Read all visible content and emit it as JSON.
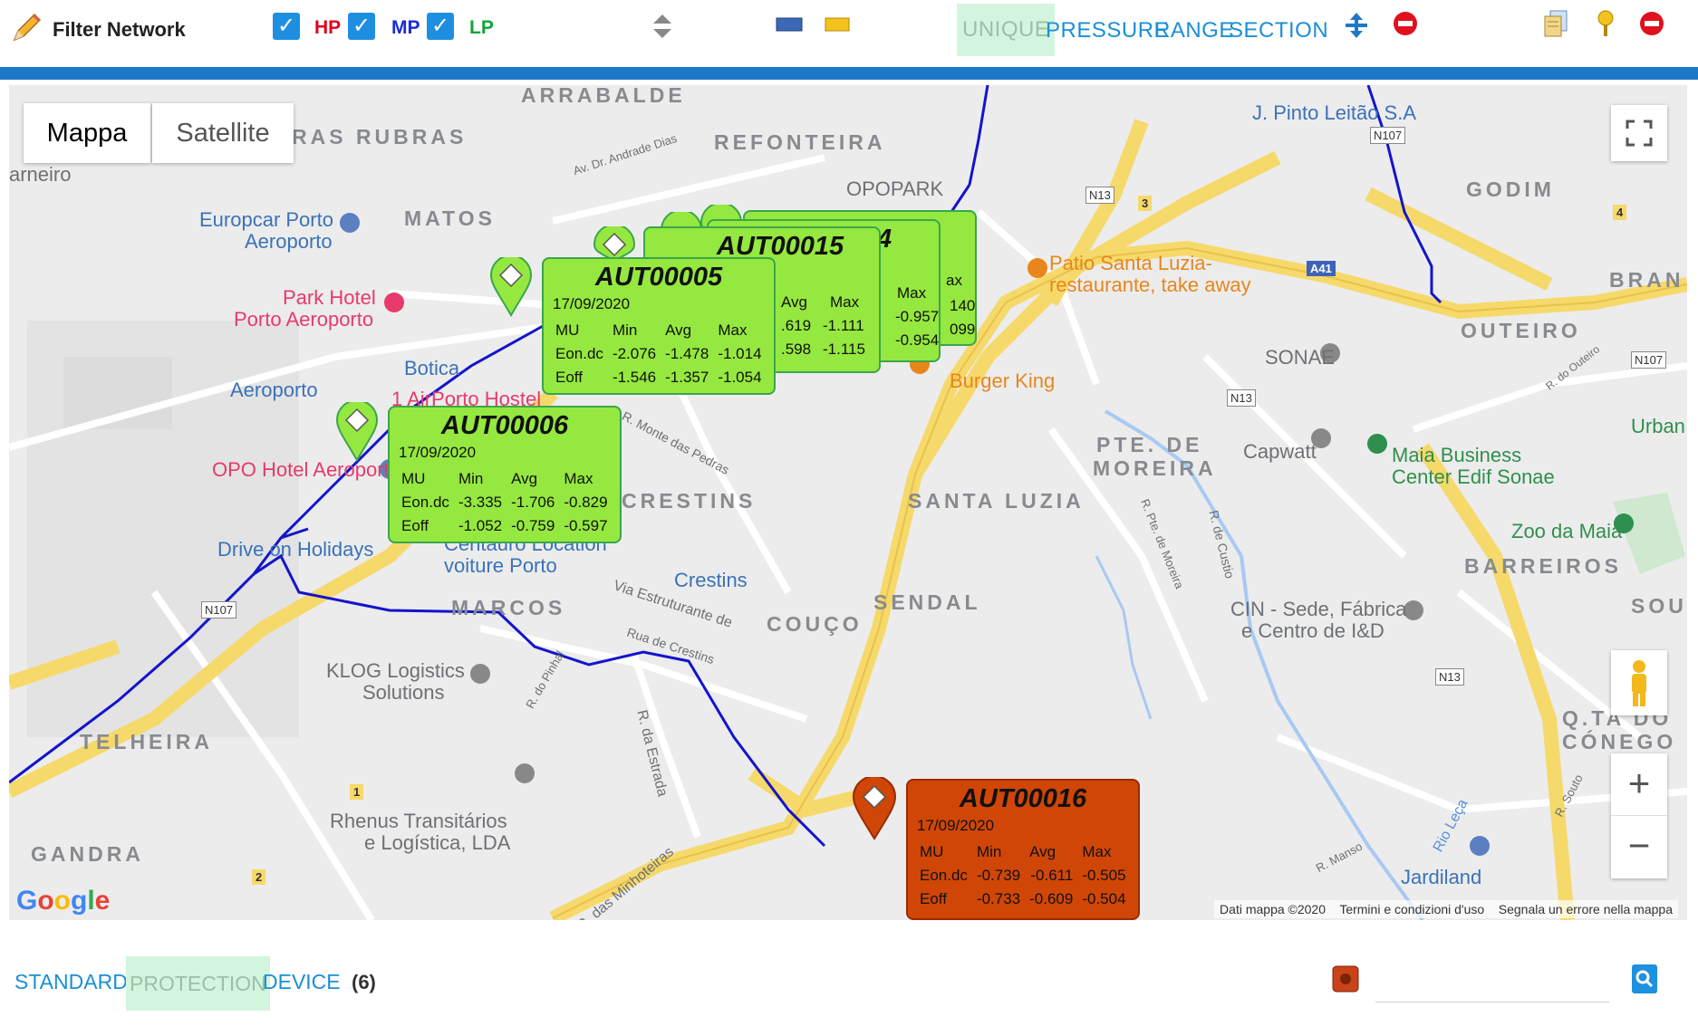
{
  "toolbar": {
    "title": "Filter Network",
    "hp_label": "HP",
    "mp_label": "MP",
    "lp_label": "LP",
    "tabs": [
      "UNIQUE",
      "PRESSURE",
      "RANGE",
      "SECTION"
    ],
    "active_tab": "UNIQUE"
  },
  "map": {
    "map_type_buttons": [
      "Mappa",
      "Satellite"
    ],
    "zoom_in": "+",
    "zoom_out": "−",
    "footer_data": "Dati mappa ©2020",
    "footer_terms": "Termini e condizioni d'uso",
    "footer_report": "Segnala un errore nella mappa",
    "google": "Google",
    "labels": {
      "arrabalde": "ARRABALDE",
      "ras_rubras": "RAS RUBRAS",
      "refonteira": "REFONTEIRA",
      "matos": "MATOS",
      "godim": "GODIM",
      "bran": "BRAN",
      "outeiro": "OUTEIRO",
      "pte_de": "PTE. DE",
      "moreira": "MOREIRA",
      "santa_luzia": "SANTA LUZIA",
      "crestins_area": "CRESTINS",
      "sendal": "SENDAL",
      "marcos": "MARCOS",
      "couco": "COUÇO",
      "barreiros": "BARREIROS",
      "sou": "SOU",
      "telheira": "TELHEIRA",
      "gandra": "GANDRA",
      "qta_do": "Q.TA DO",
      "conego": "CÓNEGO",
      "arneiro": "arneiro",
      "pinto_leitao": "J. Pinto Leitão S.A",
      "europcar": "Europcar Porto",
      "europcar2": "Aeroporto",
      "opopark": "OPOPARK",
      "park_hotel": "Park Hotel",
      "park_hotel2": "Porto Aeroporto",
      "botica": "Botica",
      "aeroporto": "Aeroporto",
      "airporto_hostel": "1 AirPorto Hostel",
      "opo_hotel": "OPO Hotel Aeroporto",
      "drive_on": "Drive on Holidays",
      "centauro": "Centauro Location",
      "centauro2": "voiture Porto",
      "crestins_metro": "Crestins",
      "klog": "KLOG Logistics",
      "klog2": "Solutions",
      "rhenus": "Rhenus Transitários",
      "rhenus2": "e Logística, LDA",
      "patio": "Patio Santa Luzia-",
      "patio2": "restaurante, take away",
      "burger_king": "Burger King",
      "sonae": "SONAE",
      "capwatt": "Capwatt",
      "maia_business": "Maia Business",
      "maia_business2": "Center Edif Sonae",
      "zoo": "Zoo da Maia",
      "cin": "CIN - Sede, Fábrica",
      "cin2": "e Centro de I&D",
      "jardiland": "Jardiland",
      "urban": "Urban",
      "av_andrade": "Av. Dr. Andrade Dias",
      "monte_pedras": "R. Monte das Pedras",
      "via_estruturante": "Via Estruturante de",
      "rua_crestins": "Rua de Crestins",
      "r_estrada": "R. da Estrada",
      "r_minhoteiras": "R. das Minhoteiras",
      "r_pinhal": "R. do Pinhal",
      "r_pte_moreira": "R. Pte. de Moreira",
      "r_custio": "R. de Custio",
      "rio_leca": "Rio Leça",
      "r_souto": "R. Souto",
      "r_manso": "R. Manso",
      "r_outeiro": "R. do Outeiro",
      "n107": "N107",
      "n13": "N13",
      "a41": "A41",
      "n107b": "N107",
      "n13b": "N13",
      "n13c": "N13",
      "n107c": "N107",
      "three": "3",
      "four": "4",
      "one": "1",
      "two": "2"
    }
  },
  "popups": [
    {
      "id": "AUT00005",
      "date": "17/09/2020",
      "header": [
        "MU",
        "Min",
        "Avg",
        "Max"
      ],
      "rows": [
        [
          "Eon.dc",
          "-2.076",
          "-1.478",
          "-1.014"
        ],
        [
          "Eoff",
          "-1.546",
          "-1.357",
          "-1.054"
        ]
      ]
    },
    {
      "id": "AUT00006",
      "date": "17/09/2020",
      "header": [
        "MU",
        "Min",
        "Avg",
        "Max"
      ],
      "rows": [
        [
          "Eon.dc",
          "-3.335",
          "-1.706",
          "-0.829"
        ],
        [
          "Eoff",
          "-1.052",
          "-0.759",
          "-0.597"
        ]
      ]
    },
    {
      "id": "AUT00015",
      "partial_avg": "Avg",
      "partial_max": "Max",
      "partial_rows": [
        [
          ".619",
          "-1.111"
        ],
        [
          ".598",
          "-1.115"
        ]
      ]
    },
    {
      "id_partial": "4",
      "partial_max": "Max",
      "partial_rows": [
        [
          "-0.957"
        ],
        [
          "-0.954"
        ]
      ]
    },
    {
      "partial_ax": "ax",
      "partial_rows": [
        [
          "140"
        ],
        [
          "099"
        ]
      ]
    },
    {
      "id": "AUT00016",
      "date": "17/09/2020",
      "header": [
        "MU",
        "Min",
        "Avg",
        "Max"
      ],
      "rows": [
        [
          "Eon.dc",
          "-0.739",
          "-0.611",
          "-0.505"
        ],
        [
          "Eoff",
          "-0.733",
          "-0.609",
          "-0.504"
        ]
      ]
    }
  ],
  "footer": {
    "tabs": [
      "STANDARD",
      "PROTECTION",
      "DEVICE"
    ],
    "active_tab": "PROTECTION",
    "count": "(6)",
    "search_placeholder": ""
  }
}
